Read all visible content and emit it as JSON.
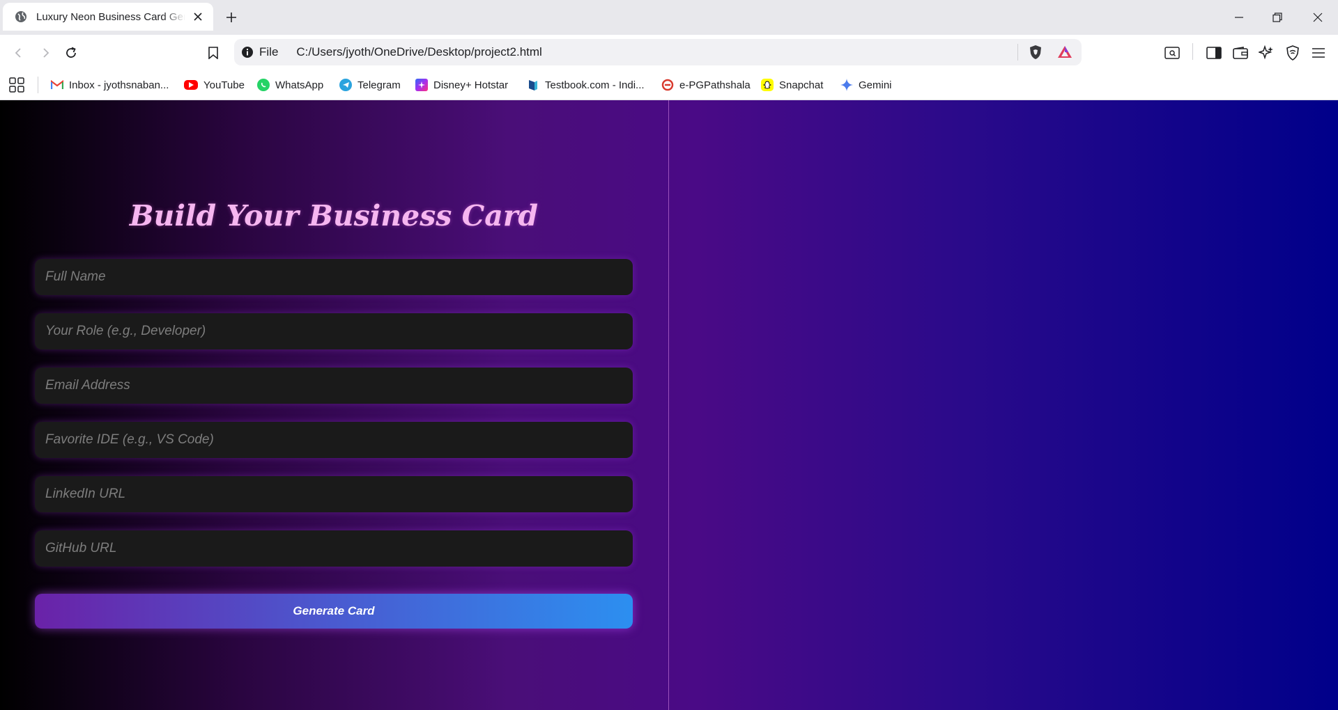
{
  "browser": {
    "tab_title": "Luxury Neon Business Card Generator",
    "address": {
      "scheme": "File",
      "url": "C:/Users/jyoth/OneDrive/Desktop/project2.html"
    },
    "bookmarks": [
      {
        "label": "Inbox - jyothsnaban...",
        "icon": "gmail-icon",
        "color": "#ea4335"
      },
      {
        "label": "YouTube",
        "icon": "youtube-icon",
        "color": "#ff0000"
      },
      {
        "label": "WhatsApp",
        "icon": "whatsapp-icon",
        "color": "#25d366"
      },
      {
        "label": "Telegram",
        "icon": "telegram-icon",
        "color": "#2aa3de"
      },
      {
        "label": "Disney+ Hotstar",
        "icon": "hotstar-icon",
        "color": "#7a3cf0"
      },
      {
        "label": "Testbook.com - Indi...",
        "icon": "testbook-icon",
        "color": "#1a4b8c"
      },
      {
        "label": "e-PGPathshala",
        "icon": "epg-icon",
        "color": "#d83a2e"
      },
      {
        "label": "Snapchat",
        "icon": "snapchat-icon",
        "color": "#fffc00"
      },
      {
        "label": "Gemini",
        "icon": "gemini-icon",
        "color": "#4b7bec"
      }
    ]
  },
  "page": {
    "title": "Build Your Business Card",
    "fields": {
      "full_name": "Full Name",
      "role": "Your Role (e.g., Developer)",
      "email": "Email Address",
      "ide": "Favorite IDE (e.g., VS Code)",
      "linkedin": "LinkedIn URL",
      "github": "GitHub URL"
    },
    "generate_label": "Generate Card"
  }
}
